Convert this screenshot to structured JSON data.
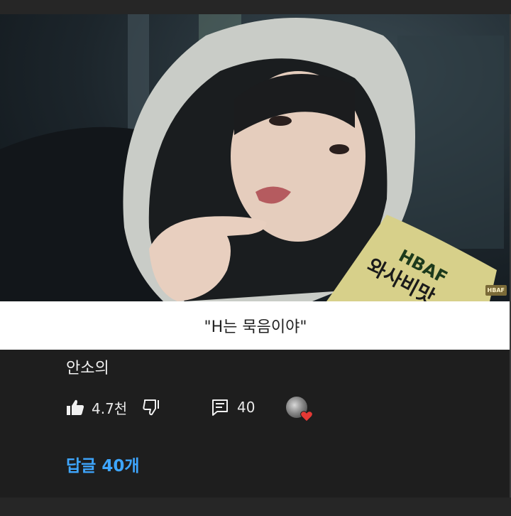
{
  "video": {
    "caption": "\"H는 묵음이야\"",
    "watermark": "HBAF",
    "bag_brand": "HBAF",
    "bag_text": "와사비맛"
  },
  "comment": {
    "text": "안소의",
    "like_count": "4.7천",
    "reply_count": "40",
    "replies_link": "답글 40개"
  },
  "icons": [
    "thumbs-up-icon",
    "thumbs-down-icon",
    "comment-icon",
    "creator-heart-icon"
  ],
  "colors": {
    "background": "#1e1e1e",
    "link": "#3ea6ff",
    "heart": "#e53935",
    "caption_bg": "#ffffff"
  }
}
